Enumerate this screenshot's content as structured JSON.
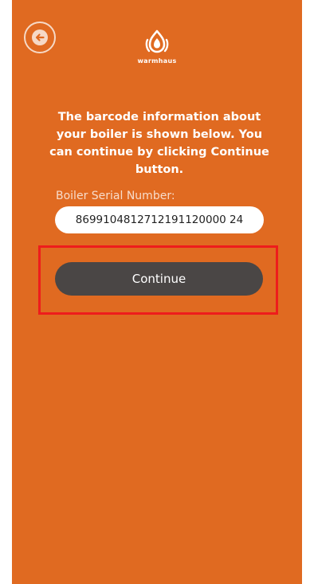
{
  "brand": {
    "name": "warmhaus",
    "logo_icon": "flame-icon"
  },
  "header": {
    "back_icon": "back-arrow-icon"
  },
  "info_text": "The barcode information about your boiler is shown below. You can continue by clicking Continue button.",
  "serial": {
    "label": "Boiler Serial Number:",
    "value": "8699104812712191120000 24"
  },
  "continue_label": "Continue",
  "colors": {
    "background": "#e06a21",
    "button": "#4a4645",
    "highlight": "#ee1c1c"
  }
}
